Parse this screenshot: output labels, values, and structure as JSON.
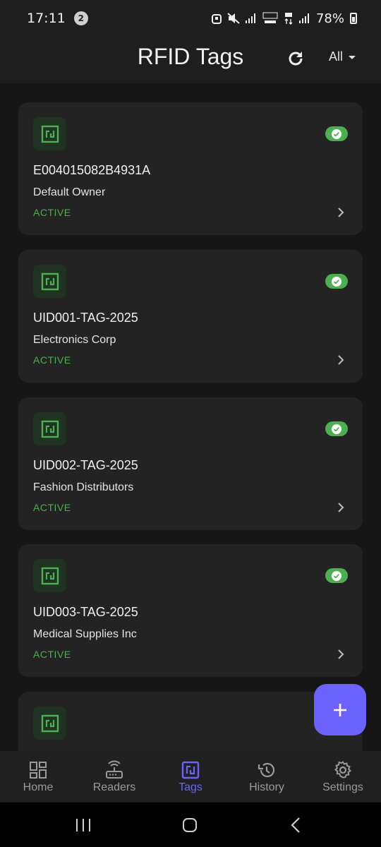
{
  "status_bar": {
    "time": "17:11",
    "notification_count": "2",
    "battery": "78%"
  },
  "app_bar": {
    "title": "RFID Tags",
    "filter_label": "All"
  },
  "tags": [
    {
      "id": "E004015082B4931A",
      "owner": "Default Owner",
      "status": "ACTIVE"
    },
    {
      "id": "UID001-TAG-2025",
      "owner": "Electronics Corp",
      "status": "ACTIVE"
    },
    {
      "id": "UID002-TAG-2025",
      "owner": "Fashion Distributors",
      "status": "ACTIVE"
    },
    {
      "id": "UID003-TAG-2025",
      "owner": "Medical Supplies Inc",
      "status": "ACTIVE"
    }
  ],
  "nav": [
    {
      "label": "Home",
      "icon": "dashboard-icon"
    },
    {
      "label": "Readers",
      "icon": "router-icon"
    },
    {
      "label": "Tags",
      "icon": "nfc-icon",
      "active": true
    },
    {
      "label": "History",
      "icon": "history-icon"
    },
    {
      "label": "Settings",
      "icon": "gear-icon"
    }
  ],
  "colors": {
    "accent": "#6c63ff",
    "success": "#4caf50",
    "card": "#232323",
    "background": "#161616"
  }
}
